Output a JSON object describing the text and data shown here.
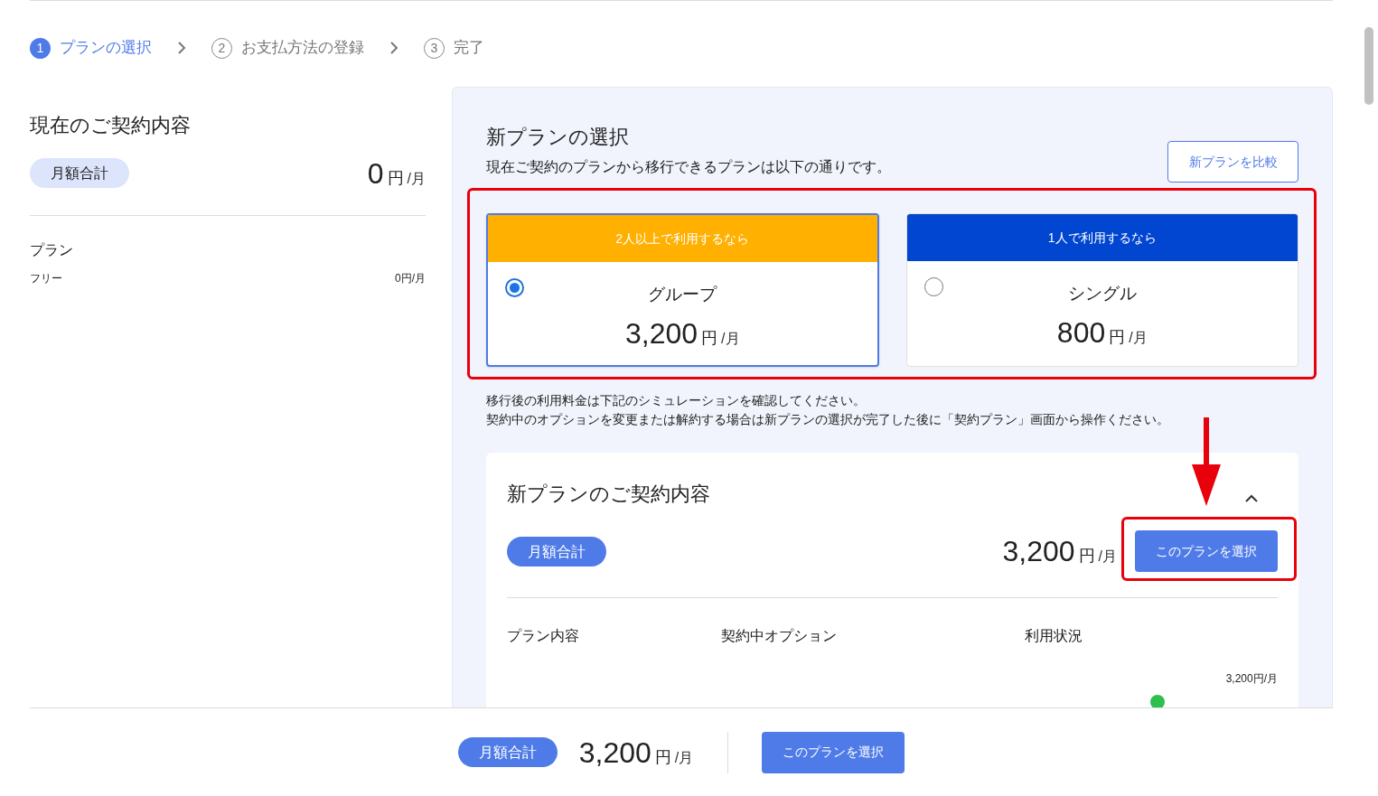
{
  "steps": [
    {
      "number": "1",
      "label": "プランの選択",
      "selected": true
    },
    {
      "number": "2",
      "label": "お支払方法の登録",
      "selected": false
    },
    {
      "number": "3",
      "label": "完了",
      "selected": false
    }
  ],
  "current_contract": {
    "title": "現在のご契約内容",
    "total_label": "月額合計",
    "amount": "0",
    "currency": "円",
    "per": "/月",
    "section_label": "プラン",
    "item_name": "フリー",
    "item_price": "0円/月"
  },
  "new_plan": {
    "title": "新プランの選択",
    "description": "現在ご契約のプランから移行できるプランは以下の通りです。",
    "compare_button": "新プランを比較",
    "plans": [
      {
        "header": "2人以上で利用するなら",
        "color": "#ffb000",
        "name": "グループ",
        "amount": "3,200",
        "currency": "円",
        "per": "/月",
        "selected": true
      },
      {
        "header": "1人で利用するなら",
        "color": "#0046d0",
        "name": "シングル",
        "amount": "800",
        "currency": "円",
        "per": "/月",
        "selected": false
      }
    ],
    "notes": [
      "移行後の利用料金は下記のシミュレーションを確認してください。",
      "契約中のオプションを変更または解約する場合は新プランの選択が完了した後に「契約プラン」画面から操作ください。"
    ]
  },
  "new_contract": {
    "title": "新プランのご契約内容",
    "expanded": true,
    "total_label": "月額合計",
    "amount": "3,200",
    "currency": "円",
    "per": "/月",
    "select_button": "このプランを選択",
    "columns": [
      "プラン内容",
      "契約中オプション",
      "利用状況"
    ],
    "row_price": "3,200円/月"
  },
  "footer": {
    "total_label": "月額合計",
    "amount": "3,200",
    "currency": "円",
    "per": "/月",
    "select_button": "このプランを選択"
  }
}
